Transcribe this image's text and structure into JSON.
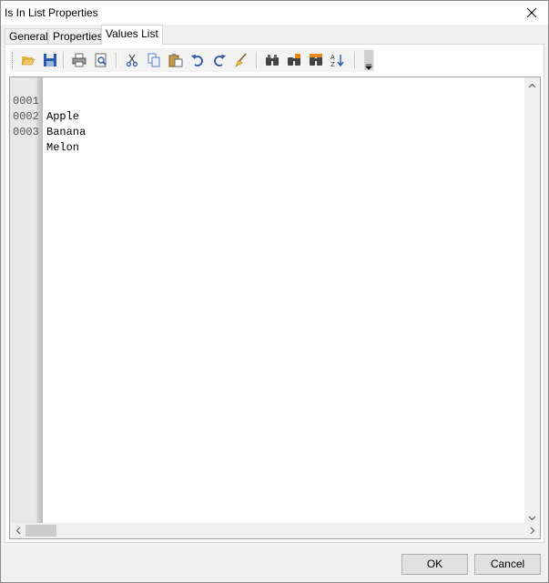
{
  "window": {
    "title": "Is In List Properties"
  },
  "tabs": [
    {
      "label": "General"
    },
    {
      "label": "Properties"
    },
    {
      "label": "Values List"
    }
  ],
  "toolbar": {
    "icons": [
      "open-folder-icon",
      "save-icon",
      "print-icon",
      "print-preview-icon",
      "cut-icon",
      "copy-icon",
      "paste-icon",
      "undo-icon",
      "redo-icon",
      "clear-icon",
      "find-icon",
      "find-next-icon",
      "replace-icon",
      "sort-icon",
      "toolbar-overflow-icon"
    ]
  },
  "editor": {
    "lines": [
      {
        "num": "0001",
        "text": "Apple"
      },
      {
        "num": "0002",
        "text": "Banana"
      },
      {
        "num": "0003",
        "text": "Melon"
      }
    ]
  },
  "buttons": {
    "ok": "OK",
    "cancel": "Cancel"
  }
}
